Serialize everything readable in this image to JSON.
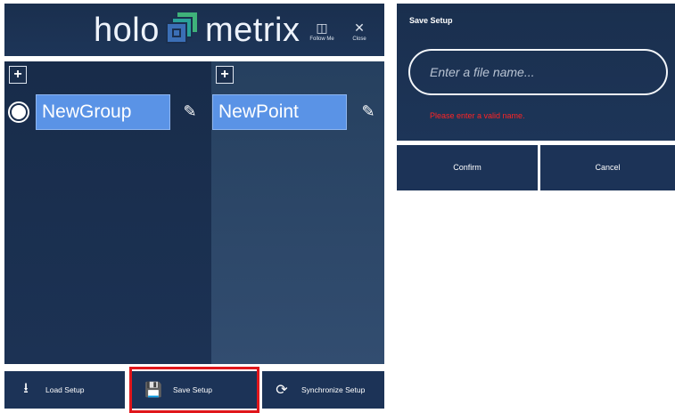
{
  "header": {
    "logo_left": "holo",
    "logo_right": "metrix",
    "follow_me_label": "Follow Me",
    "close_label": "Close",
    "brand_colors": {
      "green": "#3fb27a",
      "teal": "#2aa198",
      "blue": "#3b6fb6"
    }
  },
  "groups": {
    "add_label": "+",
    "items": [
      {
        "name": "NewGroup",
        "selected": true
      }
    ]
  },
  "points": {
    "add_label": "+",
    "items": [
      {
        "name": "NewPoint"
      }
    ]
  },
  "toolbar": {
    "load_label": "Load Setup",
    "save_label": "Save Setup",
    "sync_label": "Synchronize Setup",
    "highlight_color": "#e0161b"
  },
  "dialog": {
    "title": "Save Setup",
    "input_placeholder": "Enter a file name...",
    "input_value": "",
    "error": "Please enter a valid name.",
    "confirm_label": "Confirm",
    "cancel_label": "Cancel"
  },
  "colors": {
    "panel": "#1a2f4e",
    "field": "#5a93e6",
    "error": "#ff2424"
  }
}
